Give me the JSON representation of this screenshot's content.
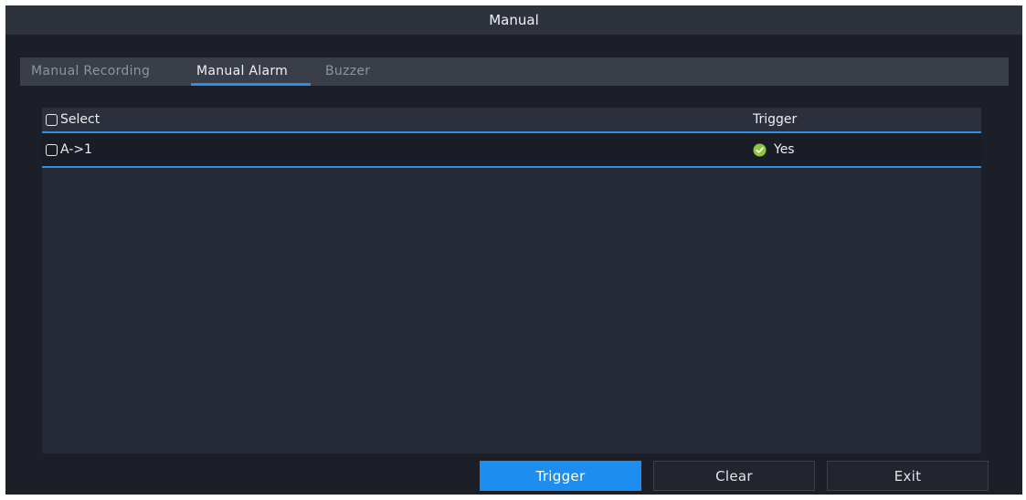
{
  "window": {
    "title": "Manual"
  },
  "tabs": [
    {
      "label": "Manual Recording",
      "active": false
    },
    {
      "label": "Manual Alarm",
      "active": true
    },
    {
      "label": "Buzzer",
      "active": false
    }
  ],
  "table": {
    "headers": {
      "select": "Select",
      "trigger": "Trigger"
    },
    "rows": [
      {
        "name": "A->1",
        "trigger": "Yes",
        "trigger_icon": "check-circle-icon",
        "checked": false
      }
    ]
  },
  "buttons": {
    "trigger": "Trigger",
    "clear": "Clear",
    "exit": "Exit"
  },
  "colors": {
    "accent": "#1d8ef0",
    "status_ok": "#8cc63f",
    "background": "#1c1f28"
  }
}
